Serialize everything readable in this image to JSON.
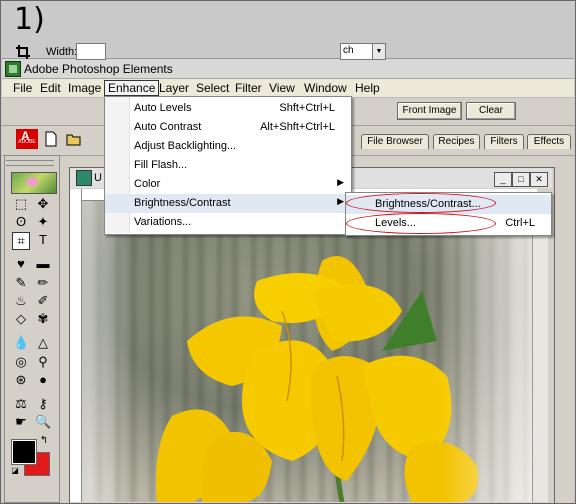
{
  "step_label": "1)",
  "app": {
    "title": "Adobe Photoshop Elements"
  },
  "menubar": [
    "File",
    "Edit",
    "Image",
    "Enhance",
    "Layer",
    "Select",
    "Filter",
    "View",
    "Window",
    "Help"
  ],
  "options_bar": {
    "width_label": "Width:",
    "resolution_value": "ch",
    "front_image_button": "Front Image",
    "clear_button": "Clear"
  },
  "shortcuts": {
    "adobe_logo": "ADOBE",
    "palette_tabs": [
      "File Browser",
      "Recipes",
      "Filters",
      "Effects"
    ]
  },
  "enhance_menu": [
    {
      "label": "Auto Levels",
      "shortcut": "Shft+Ctrl+L"
    },
    {
      "label": "Auto Contrast",
      "shortcut": "Alt+Shft+Ctrl+L"
    },
    {
      "label": "Adjust Backlighting...",
      "shortcut": ""
    },
    {
      "label": "Fill Flash...",
      "shortcut": ""
    },
    {
      "label": "Color",
      "shortcut": "",
      "submenu": true
    },
    {
      "label": "Brightness/Contrast",
      "shortcut": "",
      "submenu": true
    },
    {
      "label": "Variations...",
      "shortcut": ""
    }
  ],
  "submenu": [
    {
      "label": "Brightness/Contrast...",
      "shortcut": ""
    },
    {
      "label": "Levels...",
      "shortcut": "Ctrl+L"
    }
  ],
  "document": {
    "title": "U"
  },
  "colors": {
    "foreground": "#000000",
    "background": "#e21919",
    "highlight_oval": "#d0101a"
  }
}
